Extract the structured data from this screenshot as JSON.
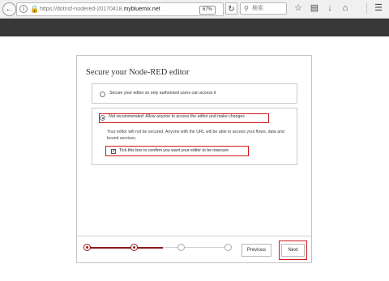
{
  "browser": {
    "url_prefix": "https://dotnsf-nodered-20170418.",
    "url_host": "mybluemix.net",
    "zoom": "67%",
    "search_placeholder": "検索",
    "icons": [
      "back-icon",
      "info-icon",
      "lock-icon",
      "reload-icon",
      "search-icon",
      "star-icon",
      "reading-list-icon",
      "download-icon",
      "home-icon",
      "menu-icon"
    ]
  },
  "dialog": {
    "title": "Secure your Node-RED editor",
    "option_secure": "Secure your editor so only authorised users can access it",
    "option_open_em": "Not recommended:",
    "option_open_rest": " Allow anyone to access the editor and make changes",
    "warning": "Your editor will not be secured. Anyone with the URL will be able to access your flows, data and bound services.",
    "confirm_label": "Tick this box to confirm you want your editor to be insecure",
    "confirm_checked": true,
    "selected_option": "open"
  },
  "footer": {
    "steps_total": 4,
    "current_step": 2,
    "previous_label": "Previous",
    "next_label": "Next"
  },
  "colors": {
    "header_dark": "#383838",
    "highlight_red": "#d11a1a",
    "step_active": "#a01818"
  }
}
